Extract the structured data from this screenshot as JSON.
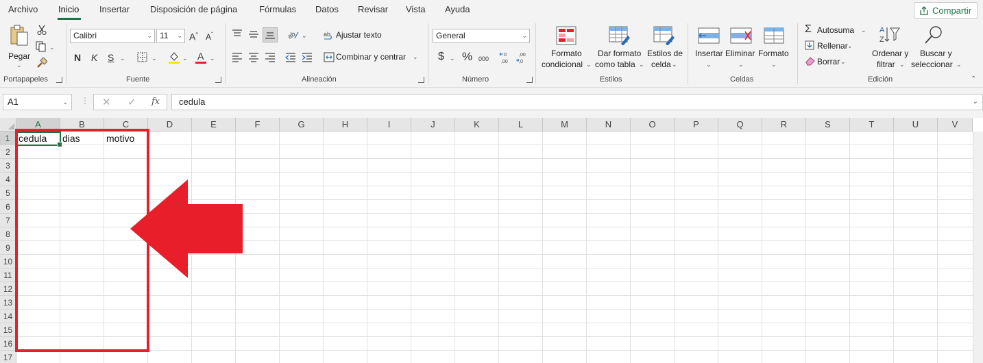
{
  "menu": {
    "tabs": [
      "Archivo",
      "Inicio",
      "Insertar",
      "Disposición de página",
      "Fórmulas",
      "Datos",
      "Revisar",
      "Vista",
      "Ayuda"
    ],
    "share": "Compartir"
  },
  "ribbon": {
    "clipboard": {
      "paste": "Pegar",
      "label": "Portapapeles"
    },
    "font": {
      "name": "Calibri",
      "size": "11",
      "bold": "N",
      "italic": "K",
      "underline": "S",
      "label": "Fuente"
    },
    "alignment": {
      "wrap": "Ajustar texto",
      "merge": "Combinar y centrar",
      "label": "Alineación"
    },
    "number": {
      "format": "General",
      "currency": "$",
      "percent": "%",
      "thousands": "000",
      "label": "Número"
    },
    "styles": {
      "conditional_l1": "Formato",
      "conditional_l2": "condicional",
      "table_l1": "Dar formato",
      "table_l2": "como tabla",
      "cell_l1": "Estilos de",
      "cell_l2": "celda",
      "label": "Estilos"
    },
    "cells": {
      "insert": "Insertar",
      "delete": "Eliminar",
      "format": "Formato",
      "label": "Celdas"
    },
    "editing": {
      "autosum": "Autosuma",
      "fill": "Rellenar",
      "clear": "Borrar",
      "sort_l1": "Ordenar y",
      "sort_l2": "filtrar",
      "find_l1": "Buscar y",
      "find_l2": "seleccionar",
      "label": "Edición"
    }
  },
  "formula_bar": {
    "name_box": "A1",
    "fx": "fx",
    "value": "cedula"
  },
  "sheet": {
    "columns": [
      "A",
      "B",
      "C",
      "D",
      "E",
      "F",
      "G",
      "H",
      "I",
      "J",
      "K",
      "L",
      "M",
      "N",
      "O",
      "P",
      "Q",
      "R",
      "S",
      "T",
      "U",
      "V"
    ],
    "rows": [
      "1",
      "2",
      "3",
      "4",
      "5",
      "6",
      "7",
      "8",
      "9",
      "10",
      "11",
      "12",
      "13",
      "14",
      "15",
      "16",
      "17"
    ],
    "selected_cell": "A1",
    "cells": [
      {
        "ref": "A1",
        "value": "cedula"
      },
      {
        "ref": "B1",
        "value": "dias"
      },
      {
        "ref": "C1",
        "value": "motivo"
      }
    ]
  },
  "colors": {
    "accent": "#217346",
    "annotation": "#e81e2b"
  }
}
